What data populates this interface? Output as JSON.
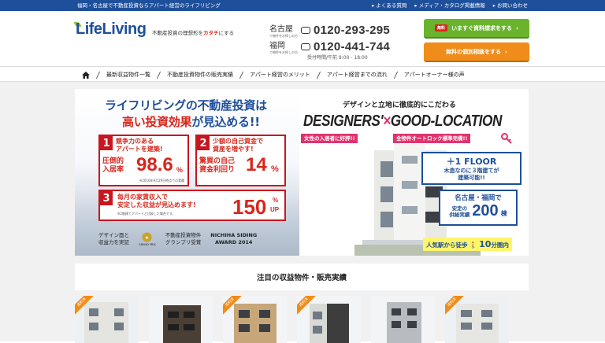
{
  "topbar": {
    "tagline": "福岡・名古屋で不動産投資ならアパート経営のライフリビング",
    "links": [
      {
        "label": "よくある質問"
      },
      {
        "label": "メディア・カタログ掲載情報"
      },
      {
        "label": "お問い合わせ"
      }
    ]
  },
  "header": {
    "logo": "LifeLiving",
    "tagline_prefix": "不動産投資の理想形を",
    "tagline_accent": "カタチ",
    "tagline_suffix": "にする",
    "phones": [
      {
        "city": "名古屋",
        "sub": "で物件をお探しの方",
        "number": "0120-293-295"
      },
      {
        "city": "福岡",
        "sub": "で物件をお探しの方",
        "number": "0120-441-744"
      }
    ],
    "hours": "受付時間/午前 9:00 - 18:00",
    "cta_catalog": {
      "badge": "無料",
      "label": "いますぐ資料請求をする"
    },
    "cta_consult": {
      "label": "無料の個別相談をする"
    }
  },
  "nav": {
    "items": [
      {
        "label": "最新収益物件一覧"
      },
      {
        "label": "不動産投資物件の販売実績"
      },
      {
        "label": "アパート経営のメリット"
      },
      {
        "label": "アパート経営までの流れ"
      },
      {
        "label": "アパートオーナー様の声"
      }
    ]
  },
  "hero": {
    "title_line1": "ライフリビングの不動産投資は",
    "title_line2_red": "高い投資効果",
    "title_line2_rest": "が見込める!!",
    "box1": {
      "num": "1",
      "head": "競争力のある\nアパートを建築!",
      "label": "圧倒的\n入居率",
      "value": "98.6",
      "unit": "%",
      "note": "※2016年9月29日時点での実績"
    },
    "box2": {
      "num": "2",
      "head": "少額の自己資金で\n資産を増やす!",
      "label": "驚異の自己\n資金利回り",
      "value": "14",
      "unit": "%"
    },
    "box3": {
      "num": "3",
      "head": "毎月の家賃収入で\n安定した収益が見込めます!",
      "value": "150",
      "unit_top": "%",
      "unit_bottom": "UP",
      "note": "※2階建てアパートと比較した場合です。"
    },
    "awards": {
      "a1": "デザイン面と\n収益力を実証",
      "a2": "不動産投資物件\nグランプリ受賞",
      "a2_badge": "GRAND PRIX",
      "a3": "NICHIHA SIDING\nAWARD 2014"
    },
    "design_sub": "デザインと立地に徹底的にこだわる",
    "design_title_a": "DESIGNERS'",
    "design_title_x": "×",
    "design_title_b": "GOOD-LOCATION",
    "tags": [
      {
        "label": "女性の入居者に好評!!"
      },
      {
        "label": "全物件オートロック標準完備!!"
      }
    ],
    "callout1": {
      "title": "＋1 FLOOR",
      "body": "木造なのに３階建てが\n建築可能!!"
    },
    "callout2": {
      "title": "名古屋・福岡で",
      "label": "安定の\n供給実績",
      "value": "200",
      "unit": "棟"
    },
    "walk": {
      "prefix": "人気駅から徒歩",
      "value": "10",
      "suffix": "分圏内"
    }
  },
  "section": {
    "title": "注目の収益物件・販売実績"
  },
  "cards": [
    {
      "ribbon": "成約済"
    },
    {
      "ribbon": ""
    },
    {
      "ribbon": "成約済"
    },
    {
      "ribbon": "成約済"
    },
    {
      "ribbon": ""
    },
    {
      "ribbon": "成約済"
    }
  ],
  "colors": {
    "brand_blue": "#1e4f9a",
    "accent_red": "#d9261c",
    "cta_green": "#6ab42d",
    "cta_orange": "#f08c1a",
    "pink": "#e0336e"
  }
}
